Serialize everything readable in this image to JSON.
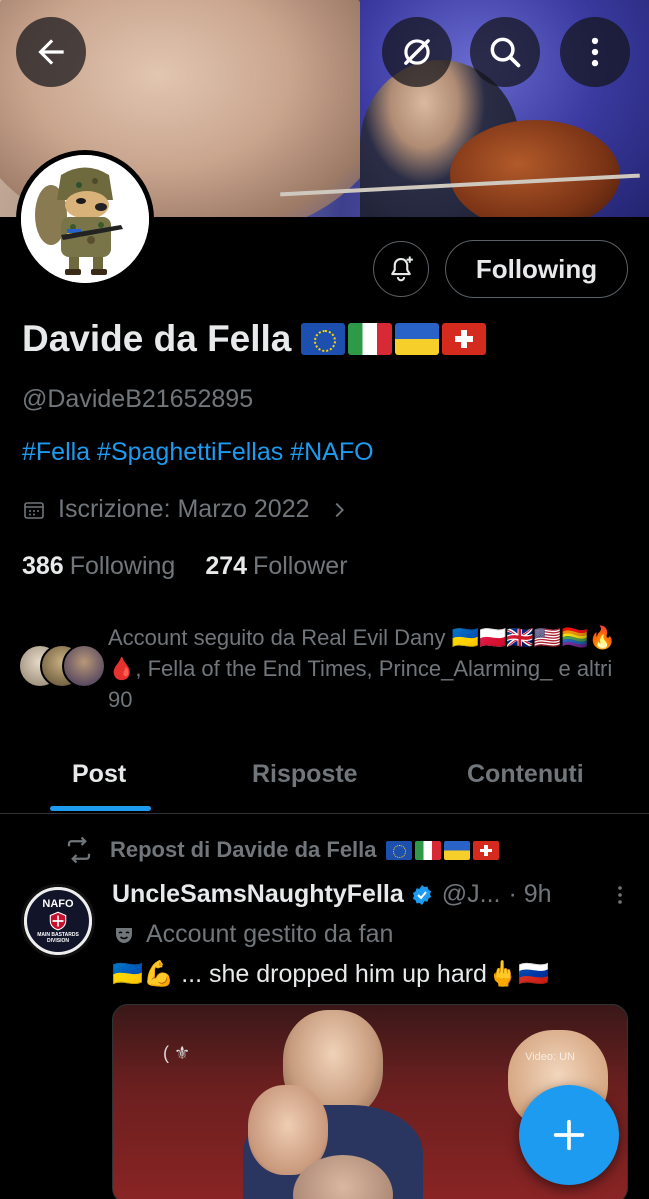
{
  "header": {
    "back_icon": "arrow-left-icon",
    "grok_icon": "grok-icon",
    "search_icon": "search-icon",
    "more_icon": "more-vertical-icon"
  },
  "profile": {
    "display_name": "Davide da Fella",
    "name_flags": [
      "eu",
      "it",
      "ua",
      "ch"
    ],
    "handle": "@DavideB21652895",
    "bio": "#Fella #SpaghettiFellas #NAFO",
    "joined": "Iscrizione: Marzo 2022",
    "following_count": "386",
    "following_label": "Following",
    "followers_count": "274",
    "followers_label": "Follower",
    "follow_button": "Following"
  },
  "followed_by": {
    "text": "Account seguito da Real Evil Dany 🇺🇦🇵🇱🇬🇧🇺🇸🏳️‍🌈🔥🩸, Fella of the End Times, Prince_Alarming_ e altri 90"
  },
  "tabs": [
    {
      "label": "Post",
      "active": true
    },
    {
      "label": "Risposte",
      "active": false
    },
    {
      "label": "Contenuti",
      "active": false
    }
  ],
  "post": {
    "repost_label": "Repost di Davide da Fella",
    "author_name": "UncleSamsNaughtyFella",
    "author_handle": "@J...",
    "time": "· 9h",
    "managed_label": "Account gestito da fan",
    "text": "🇺🇦💪 ... she dropped him up hard🖕🇷🇺",
    "avatar_text_top": "NAFO",
    "avatar_text_bottom": "MAIN BASTARDS DIVISION",
    "media_watermark": "Video: UN"
  },
  "colors": {
    "accent": "#1d9bf0",
    "background": "#000000",
    "muted": "#71767b",
    "text": "#e7e9ea"
  }
}
